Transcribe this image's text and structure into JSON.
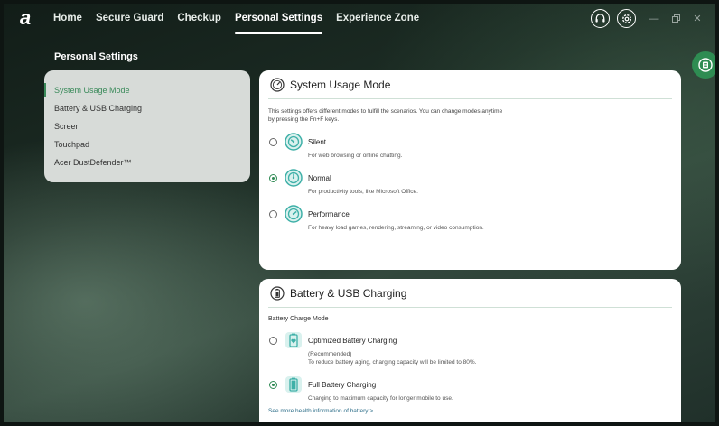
{
  "nav": {
    "logo": "a",
    "items": [
      "Home",
      "Secure Guard",
      "Checkup",
      "Personal Settings",
      "Experience Zone"
    ],
    "active": "Personal Settings"
  },
  "page": {
    "title": "Personal Settings"
  },
  "sidebar": {
    "items": [
      {
        "label": "System Usage Mode",
        "active": true
      },
      {
        "label": "Battery & USB Charging",
        "active": false
      },
      {
        "label": "Screen",
        "active": false
      },
      {
        "label": "Touchpad",
        "active": false
      },
      {
        "label": "Acer DustDefender™",
        "active": false
      }
    ]
  },
  "system_usage": {
    "title": "System Usage Mode",
    "description": "This settings offers different modes to fulfill the scenarios. You can change modes anytime by pressing the Fn+F keys.",
    "options": [
      {
        "label": "Silent",
        "desc": "For web browsing or online chatting.",
        "checked": false
      },
      {
        "label": "Normal",
        "desc": "For productivity tools, like Microsoft Office.",
        "checked": true
      },
      {
        "label": "Performance",
        "desc": "For heavy load games, rendering, streaming, or video consumption.",
        "checked": false
      }
    ]
  },
  "battery": {
    "title": "Battery & USB Charging",
    "mode_label": "Battery Charge Mode",
    "options": [
      {
        "label": "Optimized Battery Charging",
        "desc": "(Recommended)\nTo reduce battery aging, charging capacity will be limited to 80%.",
        "checked": false
      },
      {
        "label": "Full Battery Charging",
        "desc": "Charging to maximum capacity for longer mobile to use.",
        "checked": true
      }
    ],
    "more_link": "See more health information of battery >"
  },
  "colors": {
    "accent": "#2f8a54",
    "icon_teal": "#3fb0a8"
  }
}
